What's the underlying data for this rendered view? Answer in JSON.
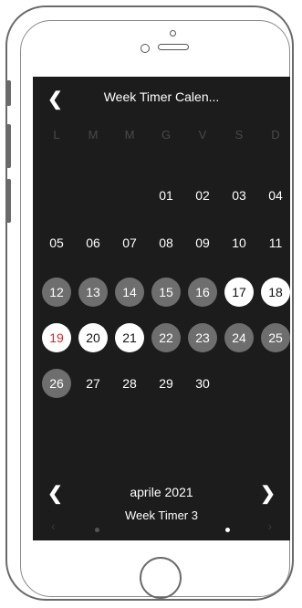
{
  "header": {
    "back_icon": "chevron-left-icon",
    "title": "Week Timer Calen..."
  },
  "weekdays": [
    "L",
    "M",
    "M",
    "G",
    "V",
    "S",
    "D"
  ],
  "calendar": {
    "weeks": [
      [
        null,
        null,
        null,
        {
          "d": "01",
          "s": "none"
        },
        {
          "d": "02",
          "s": "none"
        },
        {
          "d": "03",
          "s": "none"
        },
        {
          "d": "04",
          "s": "none"
        }
      ],
      [
        {
          "d": "05",
          "s": "none"
        },
        {
          "d": "06",
          "s": "none"
        },
        {
          "d": "07",
          "s": "none"
        },
        {
          "d": "08",
          "s": "none"
        },
        {
          "d": "09",
          "s": "none"
        },
        {
          "d": "10",
          "s": "none"
        },
        {
          "d": "11",
          "s": "none"
        }
      ],
      [
        {
          "d": "12",
          "s": "range"
        },
        {
          "d": "13",
          "s": "range"
        },
        {
          "d": "14",
          "s": "range"
        },
        {
          "d": "15",
          "s": "range"
        },
        {
          "d": "16",
          "s": "range"
        },
        {
          "d": "17",
          "s": "white"
        },
        {
          "d": "18",
          "s": "white"
        }
      ],
      [
        {
          "d": "19",
          "s": "today"
        },
        {
          "d": "20",
          "s": "white"
        },
        {
          "d": "21",
          "s": "white"
        },
        {
          "d": "22",
          "s": "range"
        },
        {
          "d": "23",
          "s": "range"
        },
        {
          "d": "24",
          "s": "range"
        },
        {
          "d": "25",
          "s": "range"
        }
      ],
      [
        {
          "d": "26",
          "s": "range"
        },
        {
          "d": "27",
          "s": "none"
        },
        {
          "d": "28",
          "s": "none"
        },
        {
          "d": "29",
          "s": "none"
        },
        {
          "d": "30",
          "s": "none"
        },
        null,
        null
      ]
    ]
  },
  "month_nav": {
    "prev_icon": "chevron-left-icon",
    "label": "aprile 2021",
    "next_icon": "chevron-right-icon"
  },
  "timer": {
    "label": "Week Timer 3",
    "active_page": 2,
    "page_count": 2
  },
  "colors": {
    "screen_bg": "#1c1c1c",
    "range": "#6e6e6e",
    "today_text": "#d9262c"
  }
}
